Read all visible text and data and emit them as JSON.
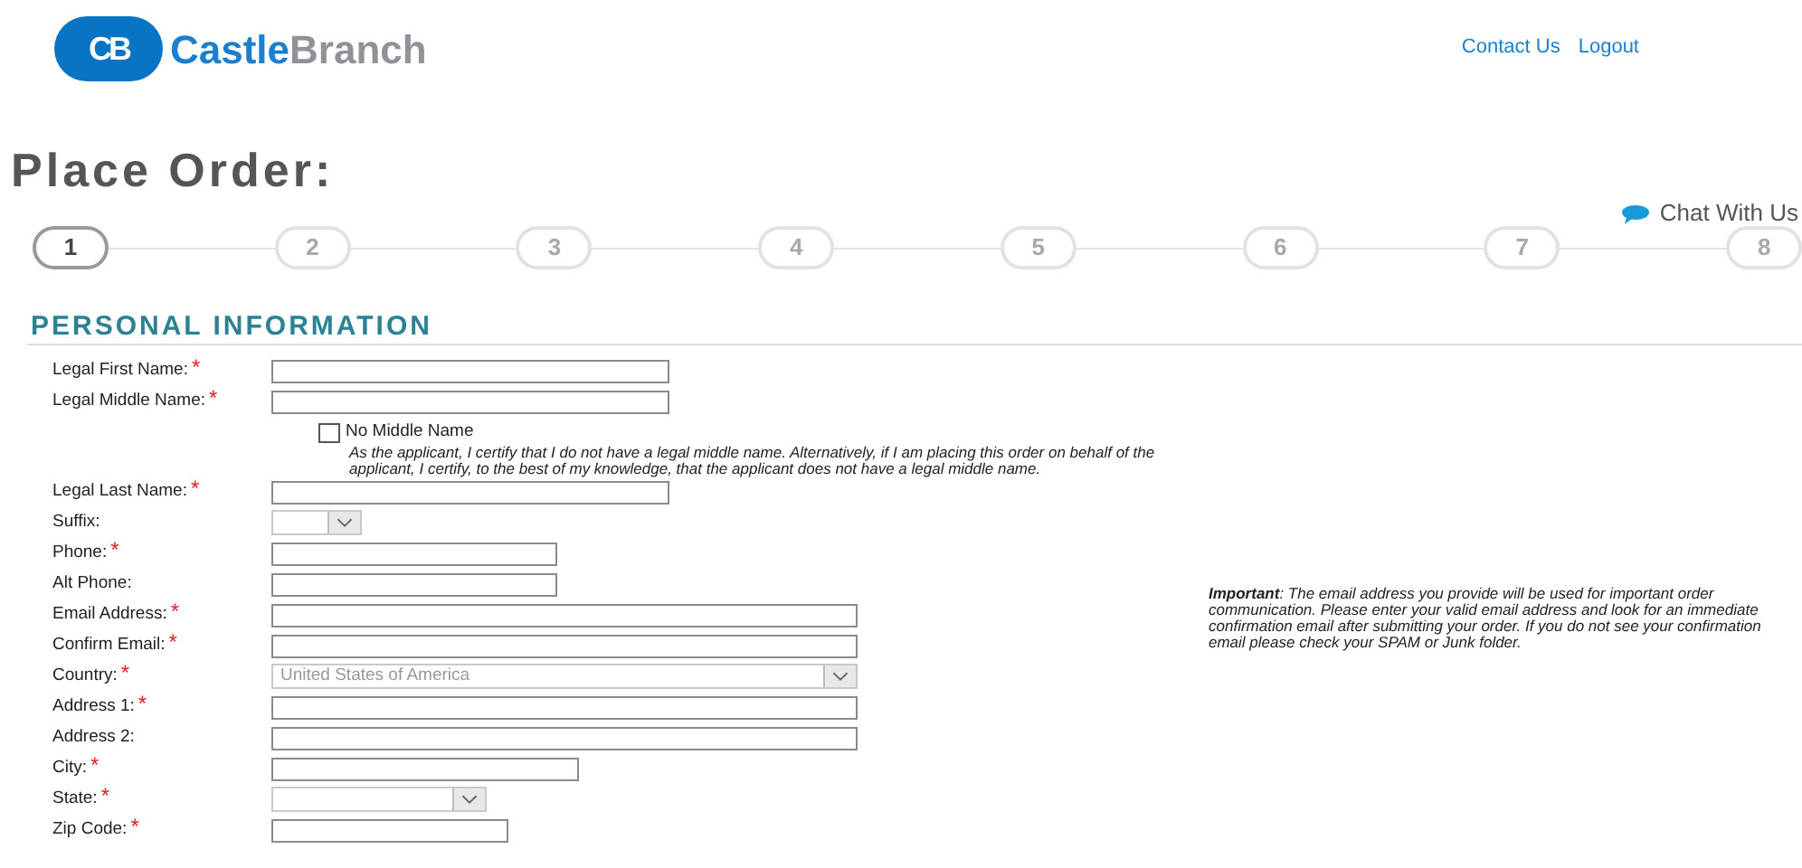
{
  "header": {
    "logo_mark": "CB",
    "brand_first": "Castle",
    "brand_second": "Branch",
    "links": [
      "Contact Us",
      "Logout"
    ]
  },
  "page_title": "Place Order:",
  "chat": "Chat With Us",
  "steps": [
    {
      "label": "1",
      "selected": true
    },
    {
      "label": "2",
      "selected": false
    },
    {
      "label": "3",
      "selected": false
    },
    {
      "label": "4",
      "selected": false
    },
    {
      "label": "5",
      "selected": false
    },
    {
      "label": "6",
      "selected": false
    },
    {
      "label": "7",
      "selected": false
    },
    {
      "label": "8",
      "selected": false
    }
  ],
  "section_title": "PERSONAL INFORMATION",
  "fields": [
    {
      "kind": "name",
      "label": "Legal First Name:",
      "marker": "*"
    },
    {
      "kind": "name",
      "label": "Legal Middle Name:",
      "marker": "*"
    },
    {
      "kind": "checkbox",
      "label": "No Middle Name",
      "checked": false,
      "note": "As the applicant, I certify that I do not have a legal middle name. Alternatively, if I am placing this order on behalf of the applicant, I certify, to the best of my knowledge, that the applicant does not have a legal middle name."
    },
    {
      "kind": "name",
      "label": "Legal Last Name:",
      "marker": "*"
    },
    {
      "kind": "suffix",
      "label": "Suffix:"
    },
    {
      "kind": "phone",
      "label": "Phone:",
      "marker": "*"
    },
    {
      "kind": "phone",
      "label": "Alt Phone:"
    },
    {
      "kind": "email",
      "label": "Email Address:",
      "marker": "*"
    },
    {
      "kind": "email",
      "label": "Confirm Email:",
      "marker": "*"
    },
    {
      "kind": "country",
      "label": "Country:",
      "marker": "*",
      "value": "United States of America"
    },
    {
      "kind": "address",
      "label": "Address 1:",
      "marker": "*"
    },
    {
      "kind": "address",
      "label": "Address 2:"
    },
    {
      "kind": "city",
      "label": "City:",
      "marker": "*"
    },
    {
      "kind": "state",
      "label": "State:",
      "marker": "*"
    },
    {
      "kind": "zip",
      "label": "Zip Code:",
      "marker": "*"
    }
  ],
  "email_note": "**Important**: The email address you provide will be used for important order communication. Please enter your valid email address and look for an immediate confirmation email after submitting your order. If you do not see your confirmation email please check your SPAM or Junk folder."
}
